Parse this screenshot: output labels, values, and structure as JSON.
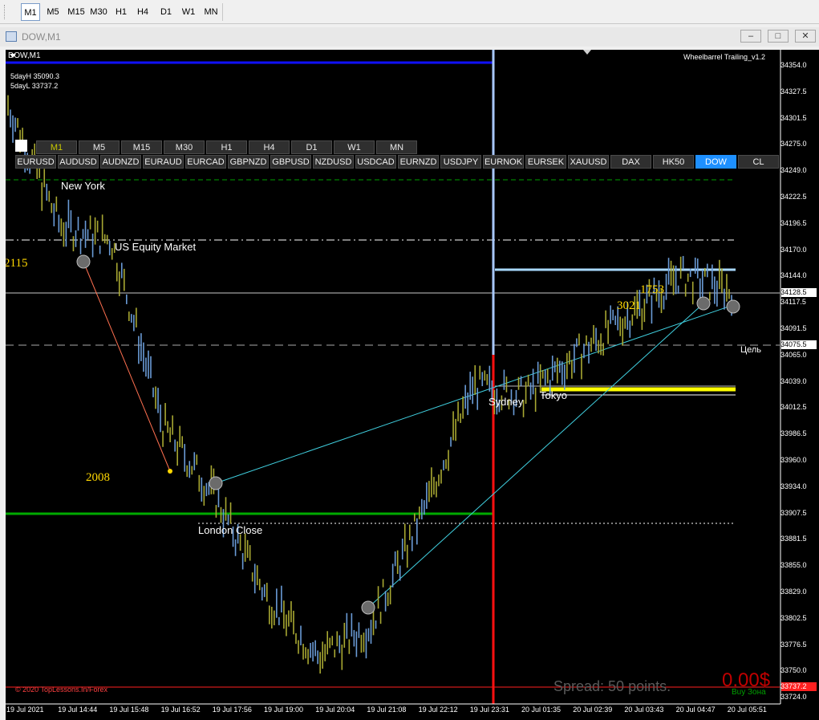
{
  "toolbar": {
    "timeframes": [
      "M1",
      "M5",
      "M15",
      "M30",
      "H1",
      "H4",
      "D1",
      "W1",
      "MN"
    ],
    "active": "M1"
  },
  "window": {
    "title": "DOW,M1",
    "minimize": "–",
    "restore": "□",
    "close": "✕"
  },
  "chart": {
    "symbol_label": "DOW,M1",
    "stats": [
      "5dayH 35090.3",
      "5dayL 33737.2"
    ],
    "indicator": "Wheelbarrel Trailing_v1.2",
    "copyright": "© 2020 TopLessons.In/Forex",
    "spread": "Spread: 50 points.",
    "profit": "0.00$",
    "zone": "Buy Зона",
    "target_label": "Цель",
    "session_labels": [
      {
        "text": "New York"
      },
      {
        "text": "US Equity Market"
      },
      {
        "text": "London Close"
      },
      {
        "text": "Sydney"
      },
      {
        "text": "Tokyo"
      }
    ],
    "numbers": [
      "2115",
      "2008",
      "1753",
      "3021"
    ],
    "tf_buttons": [
      "M1",
      "M5",
      "M15",
      "M30",
      "H1",
      "H4",
      "D1",
      "W1",
      "MN"
    ],
    "symbols": [
      "EURUSD",
      "AUDUSD",
      "AUDNZD",
      "EURAUD",
      "EURCAD",
      "GBPNZD",
      "GBPUSD",
      "NZDUSD",
      "USDCAD",
      "EURNZD",
      "USDJPY",
      "EURNOK",
      "EURSEK",
      "XAUUSD",
      "DAX",
      "HK50",
      "DOW",
      "CL"
    ],
    "active_symbol": "DOW",
    "price_labels": [
      "34354.0",
      "34327.5",
      "34301.5",
      "34275.0",
      "34249.0",
      "34222.5",
      "34196.5",
      "34170.0",
      "34144.0",
      "34117.5",
      "34091.5",
      "34065.0",
      "34039.0",
      "34012.5",
      "33986.5",
      "33960.0",
      "33934.0",
      "33907.5",
      "33881.5",
      "33855.0",
      "33829.0",
      "33802.5",
      "33776.5",
      "33750.0",
      "33724.0"
    ],
    "current_price": "34128.5",
    "target_price": "34075.5",
    "low_price": "33737.2",
    "time_labels": [
      "19 Jul 2021",
      "19 Jul 14:44",
      "19 Jul 15:48",
      "19 Jul 16:52",
      "19 Jul 17:56",
      "19 Jul 19:00",
      "19 Jul 20:04",
      "19 Jul 21:08",
      "19 Jul 22:12",
      "19 Jul 23:31",
      "20 Jul 01:35",
      "20 Jul 02:39",
      "20 Jul 03:43",
      "20 Jul 04:47",
      "20 Jul 05:51"
    ],
    "colors": {
      "background": "#000000",
      "bar_up": "#6a9bd6",
      "bar_down": "#a8a832",
      "trend": "#40d0e0",
      "red_line": "#ff2020",
      "green_line": "#00aa00",
      "yellow_zone": "#ffff00",
      "accent_button": "#1e90ff"
    }
  },
  "chart_data": {
    "type": "line",
    "title": "DOW,M1",
    "xlabel": "",
    "ylabel": "",
    "ylim": [
      33724.0,
      34354.0
    ],
    "categories": [
      "19 Jul 2021",
      "19 Jul 14:44",
      "19 Jul 15:48",
      "19 Jul 16:52",
      "19 Jul 17:56",
      "19 Jul 19:00",
      "19 Jul 20:04",
      "19 Jul 21:08",
      "19 Jul 22:12",
      "19 Jul 23:31",
      "20 Jul 01:35",
      "20 Jul 02:39",
      "20 Jul 03:43",
      "20 Jul 04:47",
      "20 Jul 05:51"
    ],
    "values": [
      34310,
      34190,
      34175,
      33990,
      33920,
      33820,
      33760,
      33790,
      33900,
      34030,
      34020,
      34060,
      34100,
      34140,
      34125
    ],
    "levels": {
      "current": 34128.5,
      "target": 34075.5,
      "low": 33737.2
    }
  }
}
